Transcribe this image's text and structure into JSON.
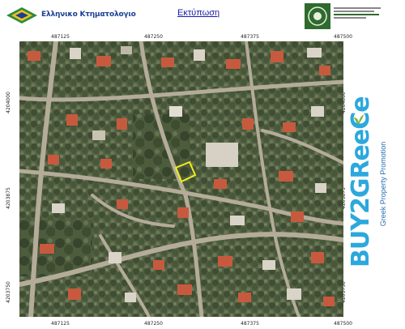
{
  "header": {
    "logo_text": "Ελληνικο Κτηματολογιο",
    "print_link": "Εκτύπωση"
  },
  "map": {
    "top_ticks": [
      "487125",
      "487250",
      "487375",
      "487500"
    ],
    "bottom_ticks": [
      "487125",
      "487250",
      "487375",
      "487500"
    ],
    "left_ticks": [
      "4204000",
      "4203875",
      "4203750"
    ],
    "right_ticks": [
      "4204000",
      "4203875",
      "4203750"
    ],
    "parcel_highlight_color": "#f2ee1b"
  },
  "brand": {
    "name": "BUY2GReeCe",
    "tagline": "Greek Property Promotion",
    "color": "#2ca8dc"
  }
}
